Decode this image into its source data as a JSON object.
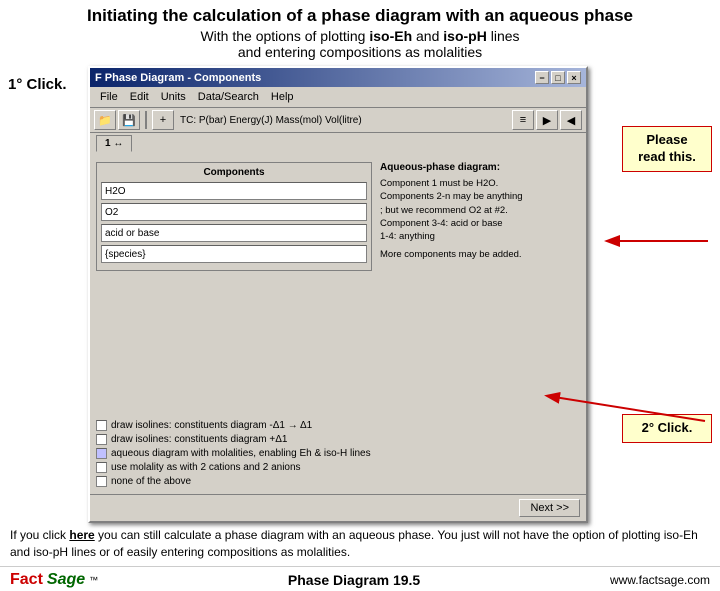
{
  "header": {
    "title": "Initiating the calculation of a phase diagram with an aqueous phase",
    "subtitle_pre": "With the options of plotting ",
    "subtitle_iso1": "iso-Eh",
    "subtitle_mid": " and ",
    "subtitle_iso2": "iso-pH",
    "subtitle_post": " lines",
    "subtitle_line2": "and entering compositions as molalities"
  },
  "left_click": {
    "label": "1°  Click."
  },
  "dialog": {
    "title": "F Phase Diagram - Components",
    "close_btn": "×",
    "min_btn": "−",
    "max_btn": "□",
    "menu_items": [
      "File",
      "Edit",
      "Units",
      "Data/Search",
      "Help"
    ],
    "toolbar_label": "TC: P(bar) Energy(J) Mass(mol) Vol(litre)",
    "tab_label": "1 ↔",
    "components_title": "Components",
    "component_values": [
      "H2O",
      "O2",
      "acid or base",
      "{species}"
    ],
    "aqueous_title": "Aqueous-phase diagram:",
    "aqueous_lines": [
      "Component 1 must be H2O.",
      "Components 2-n may be anything",
      "; but we recommend O2 at #2.",
      "Component 3-4: acid or base",
      "1-4: anything"
    ],
    "more_components": "More components may be added.",
    "checkboxes": [
      "draw isolines: constituents diagram -Δ1 → Δ1",
      "draw isolines: constituents diagram +Δ1",
      "aqueous diagram with molalities, enabling Eh & iso-H lines",
      "use molality as with 2 cations and 2 anions",
      "none of the above"
    ],
    "next_btn": "Next >>"
  },
  "callout_please_read": {
    "text": "Please\nread this."
  },
  "callout_click2": {
    "label": "2°  Click.",
    "text": "2°  Click."
  },
  "footer": {
    "text_pre": "If you click ",
    "here_text": "here",
    "text_post": " you can still calculate a phase diagram with an aqueous phase. You just will not have the option of plotting iso-Eh and iso-pH lines or of easily entering compositions as molalities.",
    "phase_label": "Phase Diagram  19.5",
    "website": "www.factsage.com"
  }
}
